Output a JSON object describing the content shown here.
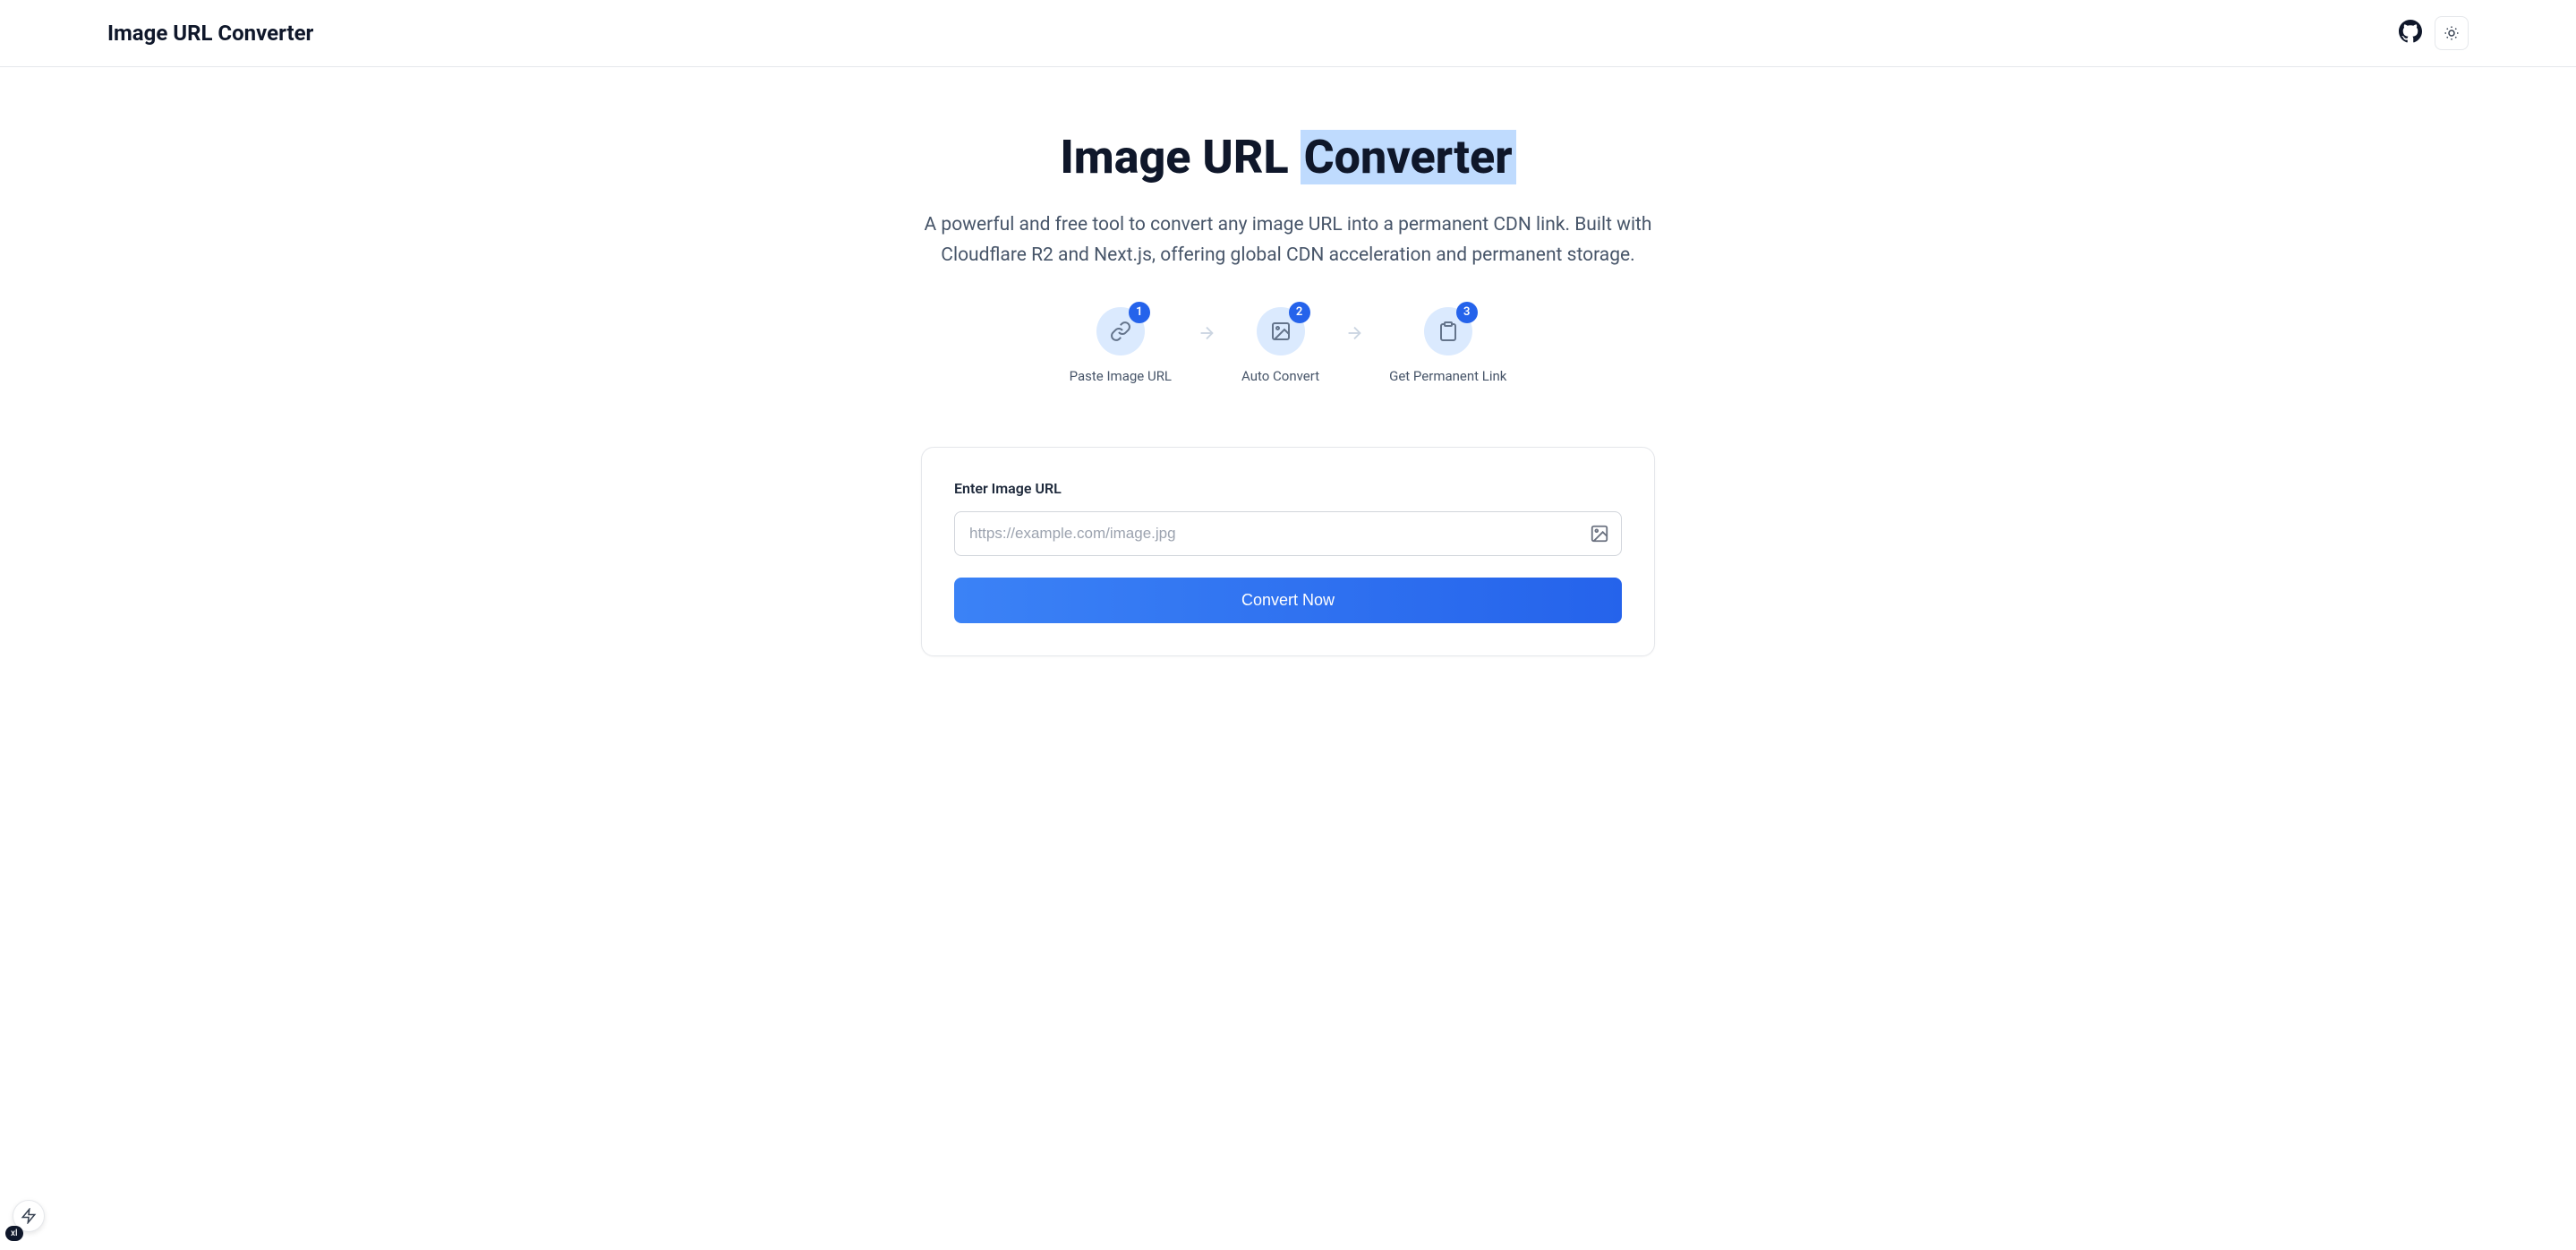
{
  "header": {
    "title": "Image URL Converter"
  },
  "hero": {
    "title_part1": "Image URL ",
    "title_part2": "Converter",
    "subtitle": "A powerful and free tool to convert any image URL into a permanent CDN link. Built with Cloudflare R2 and Next.js, offering global CDN acceleration and permanent storage."
  },
  "steps": [
    {
      "num": "1",
      "label": "Paste Image URL"
    },
    {
      "num": "2",
      "label": "Auto Convert"
    },
    {
      "num": "3",
      "label": "Get Permanent Link"
    }
  ],
  "form": {
    "label": "Enter Image URL",
    "placeholder": "https://example.com/image.jpg",
    "button": "Convert Now"
  },
  "fab_label": "xl"
}
